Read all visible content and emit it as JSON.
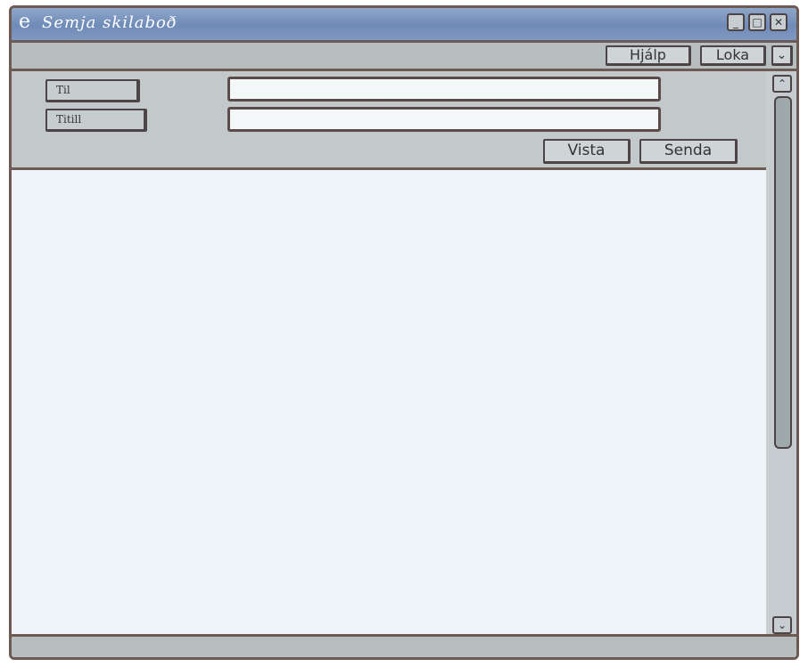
{
  "window": {
    "title_icon": "e",
    "title": "Semja skilaboð"
  },
  "window_controls": {
    "minimize_icon": "minimize-icon",
    "maximize_icon": "maximize-icon",
    "close_icon": "close-icon"
  },
  "menubar": {
    "help_label": "Hjálp",
    "close_label": "Loka",
    "dropdown_icon": "chevron-down-icon"
  },
  "fields": {
    "to_label": "Til",
    "to_value": "",
    "subject_label": "Titill",
    "subject_value": ""
  },
  "actions": {
    "save_label": "Vista",
    "send_label": "Senda"
  },
  "message_body": {
    "value": ""
  },
  "scrollbar": {
    "up_icon": "chevron-up-icon",
    "down_icon": "chevron-down-icon"
  },
  "colors": {
    "titlebar": "#6f8bb8",
    "frame": "#c9cecf",
    "border": "#6e5a55",
    "body": "#eef4f8"
  }
}
